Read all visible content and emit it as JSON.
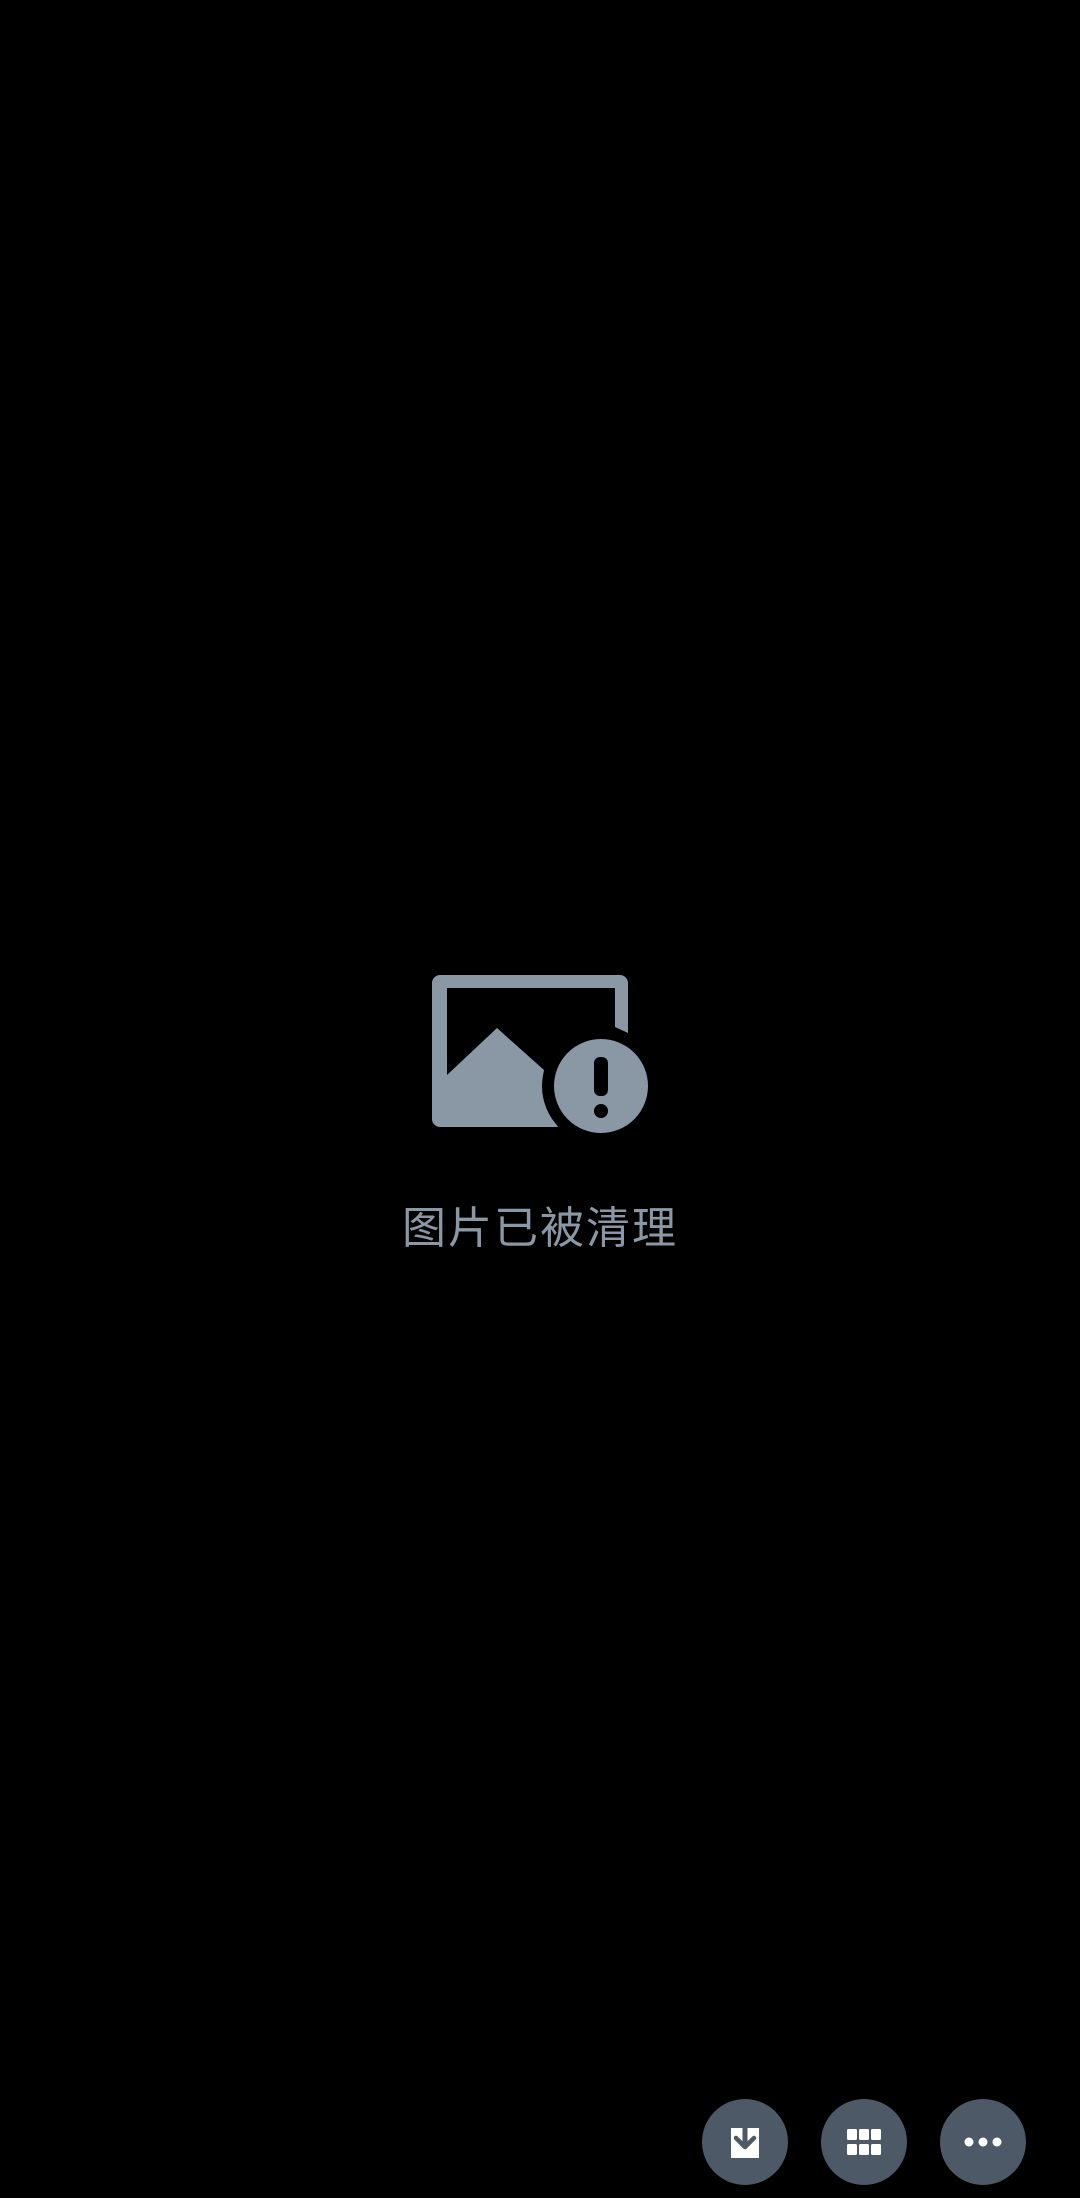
{
  "viewer": {
    "status_message": "图片已被清理"
  },
  "icons": {
    "placeholder": "broken-image-warning-icon",
    "download": "download-icon",
    "grid": "grid-icon",
    "more": "more-horizontal-icon"
  },
  "colors": {
    "background": "#000000",
    "placeholder": "#8a98a5",
    "button": "#4d5966",
    "button_icon": "#ffffff"
  }
}
